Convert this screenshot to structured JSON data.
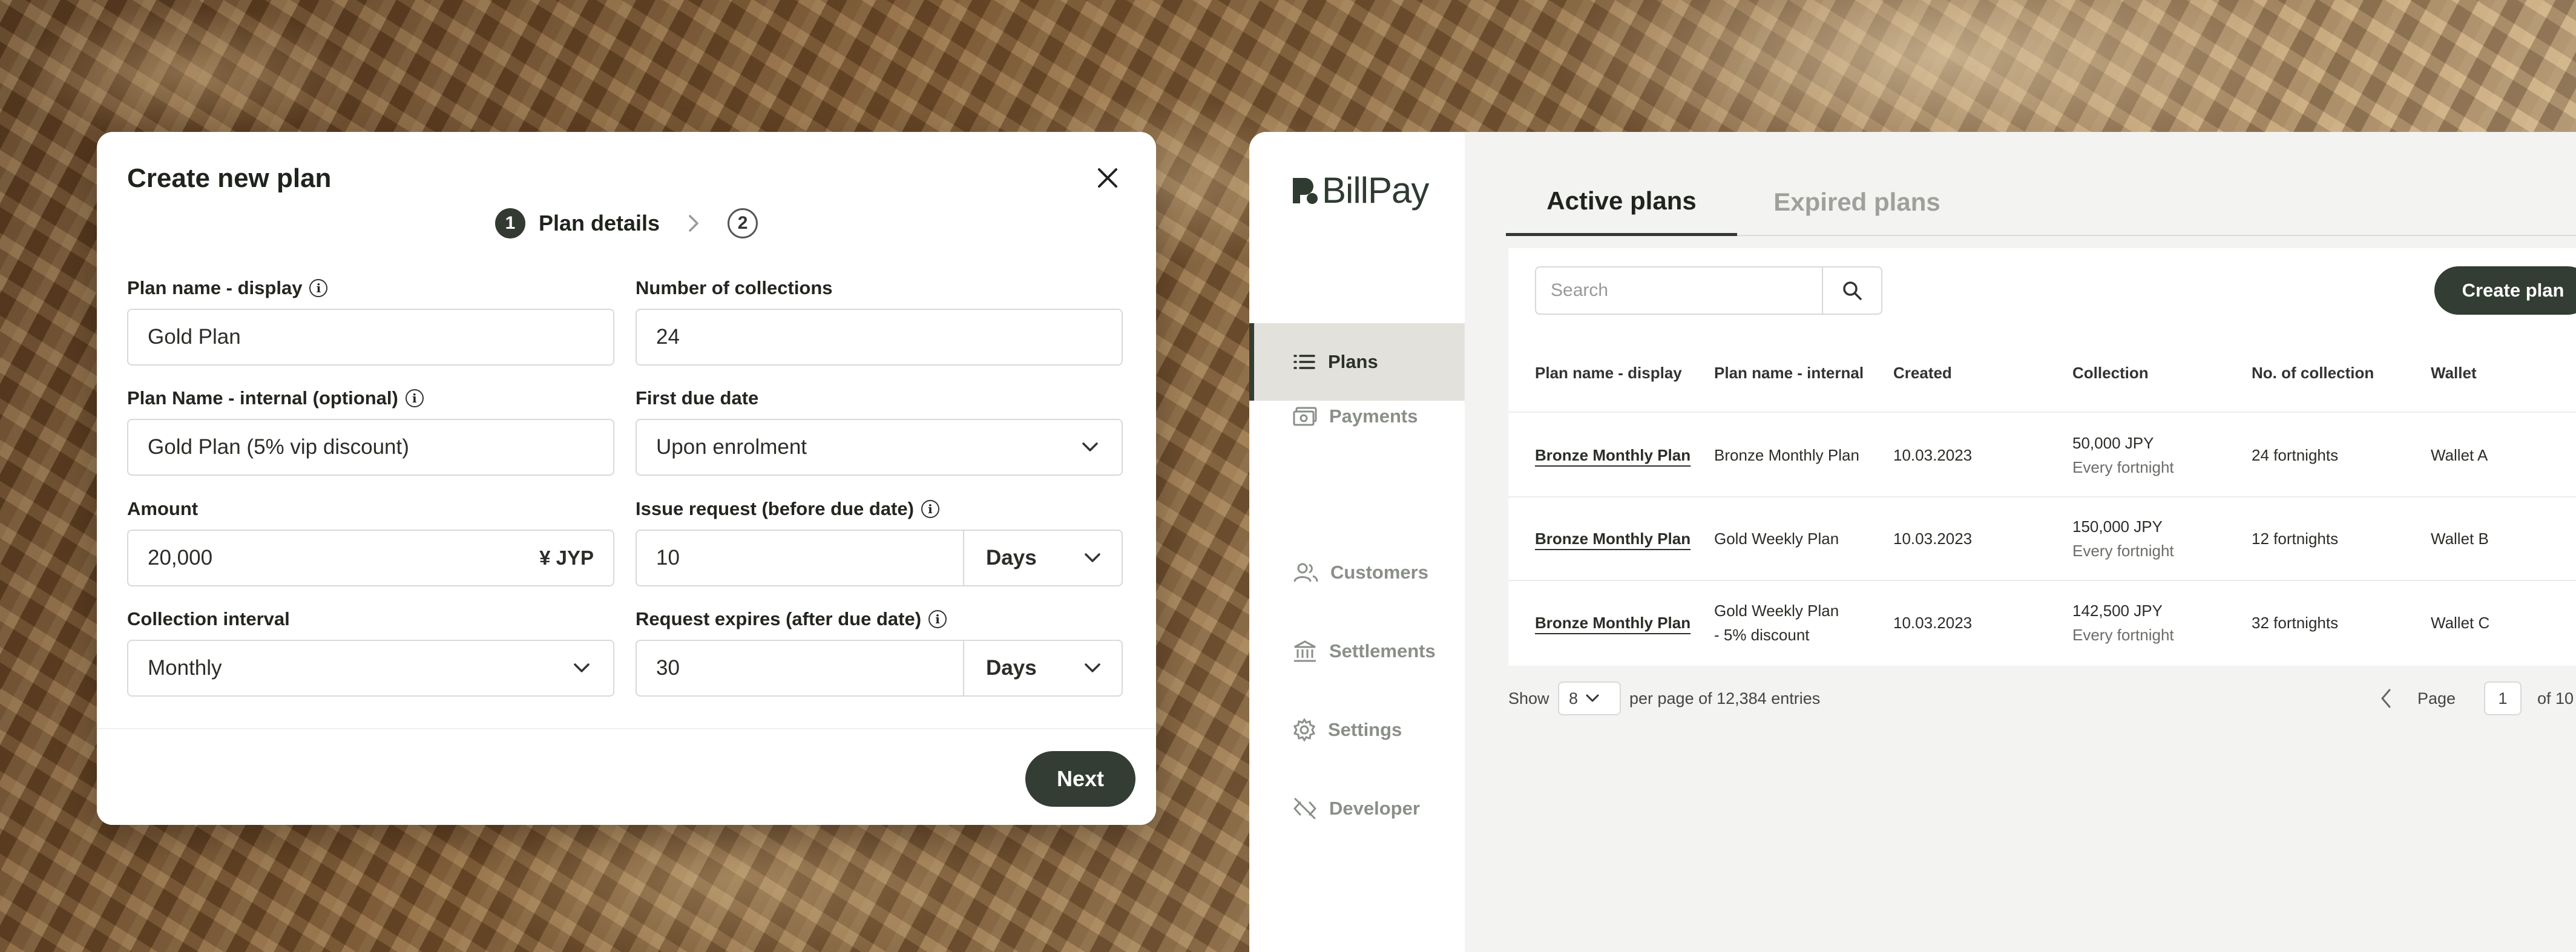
{
  "modal": {
    "title": "Create new plan",
    "stepper": {
      "step1_number": "1",
      "step1_label": "Plan details",
      "step2_number": "2"
    },
    "fields": {
      "plan_name_display": {
        "label": "Plan name - display",
        "value": "Gold Plan"
      },
      "number_of_collections": {
        "label": "Number of collections",
        "value": "24"
      },
      "plan_name_internal": {
        "label": "Plan Name - internal (optional)",
        "value": "Gold Plan (5% vip discount)"
      },
      "first_due_date": {
        "label": "First due date",
        "value": "Upon enrolment"
      },
      "amount": {
        "label": "Amount",
        "value": "20,000",
        "currency": "¥ JYP"
      },
      "issue_request": {
        "label": "Issue request (before due date)",
        "value": "10",
        "unit": "Days"
      },
      "collection_interval": {
        "label": "Collection interval",
        "value": "Monthly"
      },
      "request_expires": {
        "label": "Request expires (after due date)",
        "value": "30",
        "unit": "Days"
      }
    },
    "next_label": "Next"
  },
  "app": {
    "logo_text": "BillPay",
    "sidebar": [
      {
        "label": "Payments",
        "icon": "banknote-icon"
      },
      {
        "label": "Plans",
        "icon": "list-icon",
        "active": true
      },
      {
        "label": "Customers",
        "icon": "users-icon"
      },
      {
        "label": "Settlements",
        "icon": "bank-icon"
      },
      {
        "label": "Settings",
        "icon": "gear-icon"
      },
      {
        "label": "Developer",
        "icon": "code-off-icon"
      }
    ],
    "tabs": {
      "active": "Active plans",
      "expired": "Expired plans"
    },
    "search_placeholder": "Search",
    "create_label": "Create plan",
    "columns": [
      "Plan name - display",
      "Plan name - internal",
      "Created",
      "Collection",
      "No. of collection",
      "Wallet"
    ],
    "rows": [
      {
        "display": "Bronze Monthly Plan",
        "internal": [
          "Bronze Monthly Plan"
        ],
        "created": "10.03.2023",
        "amount": "50,000 JPY",
        "frequency": "Every fortnight",
        "count": "24 fortnights",
        "wallet": "Wallet A"
      },
      {
        "display": "Bronze Monthly Plan",
        "internal": [
          "Gold Weekly Plan"
        ],
        "created": "10.03.2023",
        "amount": "150,000 JPY",
        "frequency": "Every fortnight",
        "count": "12 fortnights",
        "wallet": "Wallet B"
      },
      {
        "display": "Bronze Monthly Plan",
        "internal": [
          "Gold Weekly Plan",
          "- 5% discount"
        ],
        "created": "10.03.2023",
        "amount": "142,500 JPY",
        "frequency": "Every fortnight",
        "count": "32 fortnights",
        "wallet": "Wallet C"
      }
    ],
    "pagination": {
      "show_label": "Show",
      "per_page": "8",
      "per_page_suffix": "per page of 12,384 entries",
      "page_label": "Page",
      "page": "1",
      "of_label": "of 10"
    }
  },
  "colors": {
    "accent": "#333d33",
    "active_nav_bg": "#e3e1dc",
    "panel_bg": "#f3f3f2"
  }
}
